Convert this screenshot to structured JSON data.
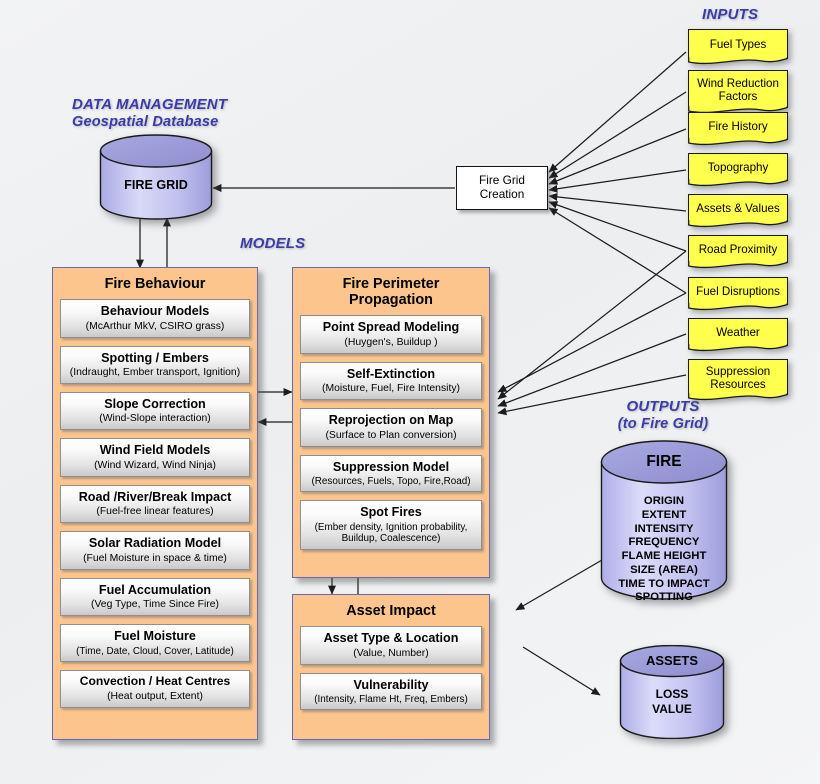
{
  "headings": {
    "inputs": "INPUTS",
    "data_management_line1": "DATA MANAGEMENT",
    "data_management_line2": "Geospatial Database",
    "models": "MODELS",
    "outputs_line1": "OUTPUTS",
    "outputs_line2": "(to Fire Grid)"
  },
  "colors": {
    "background": "#eff0f2",
    "input_fill": "#ffff4d",
    "group_fill": "#fbc58d",
    "group_border": "#6a6ab4",
    "cylinder_top": "#9a9ad8",
    "cylinder_body": "#c5c5f0",
    "heading_text": "#3b3ba8",
    "item_gradient_top": "#ffffff",
    "item_gradient_bottom": "#c9c9c9"
  },
  "inputs": [
    {
      "label": "Fuel Types"
    },
    {
      "label": "Wind Reduction Factors"
    },
    {
      "label": "Fire History"
    },
    {
      "label": "Topography"
    },
    {
      "label": "Assets & Values"
    },
    {
      "label": "Road Proximity"
    },
    {
      "label": "Fuel Disruptions"
    },
    {
      "label": "Weather"
    },
    {
      "label": "Suppression Resources"
    }
  ],
  "process": {
    "fire_grid_creation": "Fire Grid Creation"
  },
  "database": {
    "fire_grid_label": "FIRE GRID"
  },
  "groups": [
    {
      "id": "fire-behaviour",
      "title": "Fire Behaviour",
      "items": [
        {
          "name": "Behaviour Models",
          "detail": "(McArthur MkV, CSIRO  grass)"
        },
        {
          "name": "Spotting / Embers",
          "detail": "(Indraught,  Ember transport, Ignition)"
        },
        {
          "name": "Slope Correction",
          "detail": "(Wind-Slope interaction)"
        },
        {
          "name": "Wind Field Models",
          "detail": "(Wind Wizard, Wind Ninja)"
        },
        {
          "name": "Road /River/Break Impact",
          "detail": "(Fuel-free linear features)"
        },
        {
          "name": "Solar Radiation Model",
          "detail": "(Fuel Moisture in space & time)"
        },
        {
          "name": "Fuel Accumulation",
          "detail": "(Veg Type, Time Since Fire)"
        },
        {
          "name": "Fuel Moisture",
          "detail": "(Time, Date, Cloud, Cover, Latitude)"
        },
        {
          "name": "Convection / Heat Centres",
          "detail": "(Heat output, Extent)"
        }
      ]
    },
    {
      "id": "fire-perimeter-propagation",
      "title": "Fire Perimeter Propagation",
      "items": [
        {
          "name": "Point Spread Modeling",
          "detail": "(Huygen's, Buildup )"
        },
        {
          "name": "Self-Extinction",
          "detail": "(Moisture, Fuel,  Fire Intensity)"
        },
        {
          "name": "Reprojection on Map",
          "detail": "(Surface to Plan conversion)"
        },
        {
          "name": "Suppression Model",
          "detail": "(Resources, Fuels, Topo, Fire,Road)"
        },
        {
          "name": "Spot Fires",
          "detail": "(Ember density, Ignition probability, Buildup, Coalescence)"
        }
      ]
    },
    {
      "id": "asset-impact",
      "title": "Asset Impact",
      "items": [
        {
          "name": "Asset  Type & Location",
          "detail": "(Value, Number)"
        },
        {
          "name": "Vulnerability",
          "detail": "(Intensity, Flame Ht, Freq, Embers)"
        }
      ]
    }
  ],
  "outputs": [
    {
      "id": "fire-output",
      "title": "FIRE",
      "attributes": [
        "ORIGIN",
        "EXTENT",
        "INTENSITY",
        "FREQUENCY",
        "FLAME HEIGHT",
        "SIZE (AREA)",
        "TIME TO IMPACT",
        "SPOTTING"
      ]
    },
    {
      "id": "assets-output",
      "title": "ASSETS",
      "attributes": [
        "LOSS",
        "VALUE"
      ]
    }
  ]
}
